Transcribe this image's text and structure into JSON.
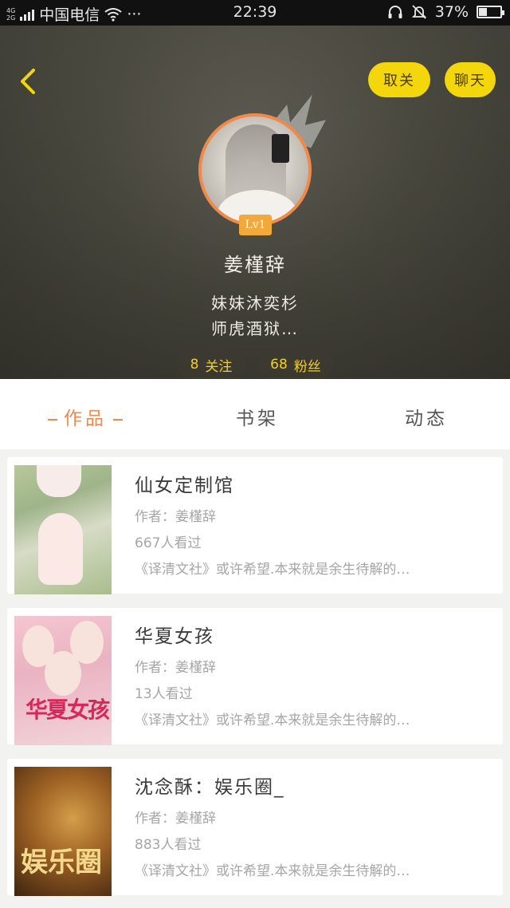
{
  "status_bar": {
    "network_top": "4G",
    "network_bottom": "2G",
    "carrier": "中国电信",
    "more": "···",
    "time": "22:39",
    "battery_percent": "37%",
    "battery_level": 0.37
  },
  "header": {
    "unfollow_label": "取关",
    "chat_label": "聊天",
    "level": "Lv1",
    "username": "姜槿辞",
    "bio_line1": "妹妹沐奕杉",
    "bio_line2": "师虎酒狱…",
    "following_count": "8",
    "following_label": "关注",
    "fans_count": "68",
    "fans_label": "粉丝"
  },
  "tabs": [
    {
      "label": "作品",
      "active": true
    },
    {
      "label": "书架",
      "active": false
    },
    {
      "label": "动态",
      "active": false
    }
  ],
  "works": [
    {
      "title": "仙女定制馆",
      "author": "作者：姜槿辞",
      "views": "667人看过",
      "desc": "《译清文社》或许希望.本来就是余生待解的…"
    },
    {
      "title": "华夏女孩",
      "author": "作者：姜槿辞",
      "views": "13人看过",
      "desc": "《译清文社》或许希望.本来就是余生待解的…",
      "cover_text": "华夏女孩"
    },
    {
      "title": "沈念酥：娱乐圈_",
      "author": "作者：姜槿辞",
      "views": "883人看过",
      "desc": "《译清文社》或许希望.本来就是余生待解的…",
      "cover_text": "娱乐圈"
    }
  ],
  "colors": {
    "accent": "#ef8a4c",
    "button_yellow": "#f4d60c",
    "stat_text": "#f2cf2a"
  }
}
